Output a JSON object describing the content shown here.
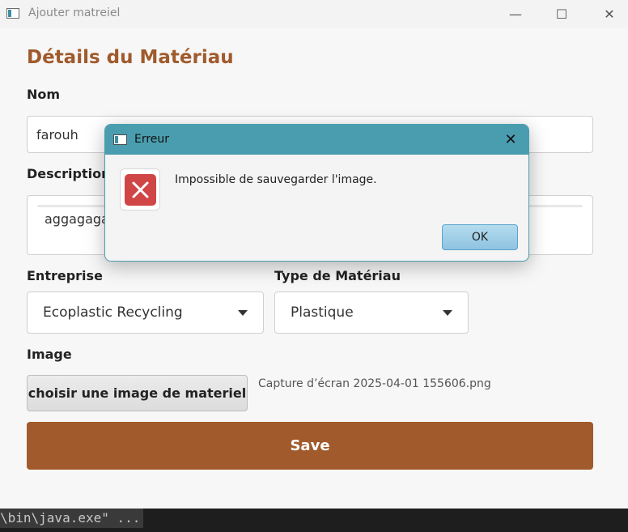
{
  "window": {
    "title": "Ajouter matreiel",
    "minimize_glyph": "—",
    "maximize_glyph": "☐",
    "close_glyph": "✕"
  },
  "form": {
    "heading": "Détails du Matériau",
    "name": {
      "label": "Nom",
      "value": "farouh"
    },
    "description": {
      "label": "Description",
      "value": "aggagagagaga"
    },
    "company": {
      "label": "Entreprise",
      "selected": "Ecoplastic Recycling"
    },
    "material_type": {
      "label": "Type de Matériau",
      "selected": "Plastique"
    },
    "image": {
      "label": "Image",
      "button_label": "choisir une image de materiel",
      "file_name": "Capture d’écran 2025-04-01 155606.png"
    },
    "save_label": "Save"
  },
  "dialog": {
    "title": "Erreur",
    "message": "Impossible de sauvegarder l'image.",
    "ok_label": "OK",
    "close_glyph": "✕",
    "icon": "error-icon"
  },
  "terminal": {
    "text": "\\bin\\java.exe\" ..."
  },
  "colors": {
    "accent": "#a05a2c",
    "dialog_titlebar": "#4a9dae",
    "ok_button": "#9ccbe5",
    "error_red": "#d04545"
  }
}
